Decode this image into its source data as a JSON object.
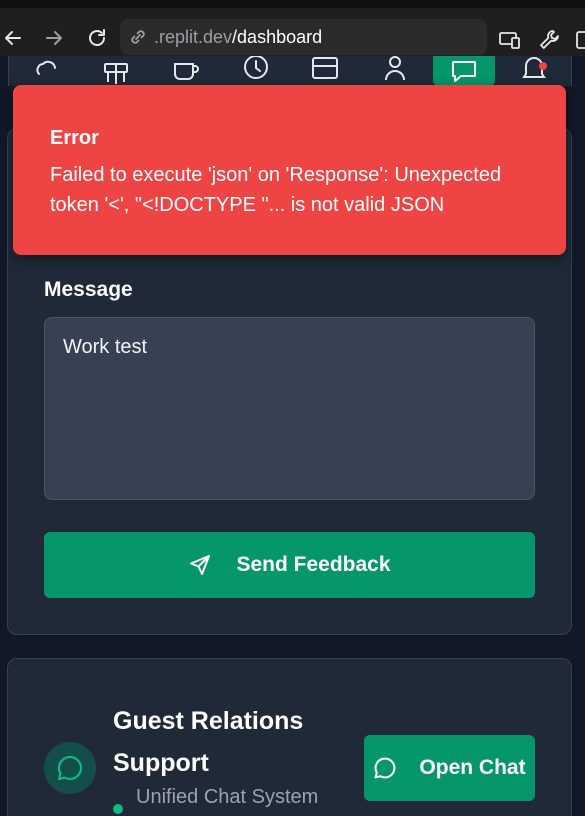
{
  "browser": {
    "url_host": ".replit.dev",
    "url_path": "/dashboard"
  },
  "app_nav": {
    "items": [
      {
        "icon": "cloud-icon"
      },
      {
        "icon": "gift-icon"
      },
      {
        "icon": "coffee-icon"
      },
      {
        "icon": "clock-icon"
      },
      {
        "icon": "card-icon"
      },
      {
        "icon": "user-icon"
      },
      {
        "icon": "chat-icon",
        "active": true
      },
      {
        "icon": "bell-icon"
      }
    ],
    "active_color": "#059669"
  },
  "toast": {
    "title": "Error",
    "message": "Failed to execute 'json' on 'Response': Unexpected token '<', \"<!DOCTYPE \"... is not valid JSON",
    "color": "#ef4444"
  },
  "feedback": {
    "message_label": "Message",
    "message_value": "Work test",
    "send_label": "Send Feedback"
  },
  "support": {
    "title": "Guest Relations Support",
    "subtitle": "Unified Chat System",
    "open_chat_label": "Open Chat",
    "accent": "#059669"
  }
}
